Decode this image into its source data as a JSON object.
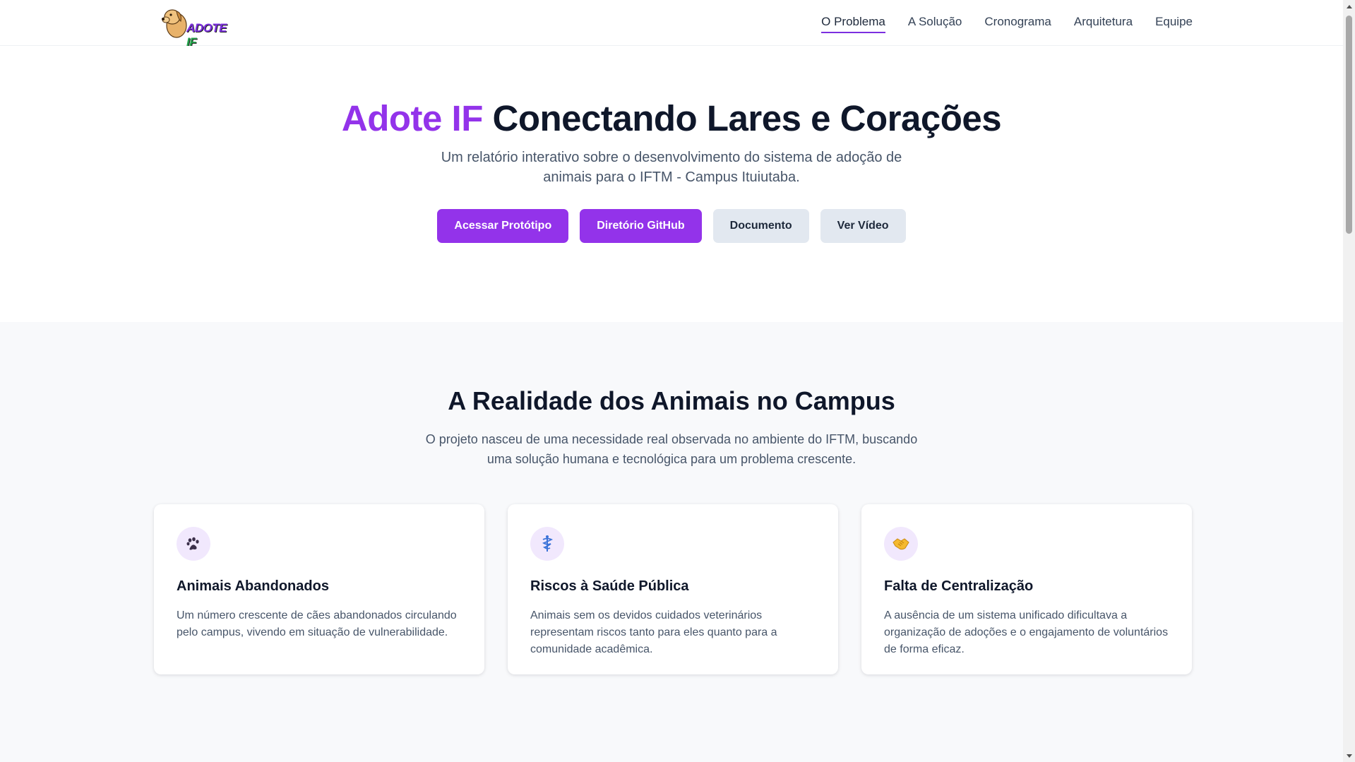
{
  "brand": {
    "logo_text": "ADOTE",
    "logo_text_if": "IF"
  },
  "nav": {
    "items": [
      {
        "label": "O Problema",
        "active": true
      },
      {
        "label": "A Solução",
        "active": false
      },
      {
        "label": "Cronograma",
        "active": false
      },
      {
        "label": "Arquitetura",
        "active": false
      },
      {
        "label": "Equipe",
        "active": false
      }
    ]
  },
  "hero": {
    "title_accent": "Adote IF",
    "title_rest": " Conectando Lares e Corações",
    "subtitle": "Um relatório interativo sobre o desenvolvimento do sistema de adoção de animais para o IFTM - Campus Ituiutaba.",
    "buttons": [
      {
        "label": "Acessar Protótipo",
        "style": "primary"
      },
      {
        "label": "Diretório GitHub",
        "style": "primary"
      },
      {
        "label": "Documento",
        "style": "secondary"
      },
      {
        "label": "Ver Vídeo",
        "style": "secondary"
      }
    ]
  },
  "problem": {
    "title": "A Realidade dos Animais no Campus",
    "lead": "O projeto nasceu de uma necessidade real observada no ambiente do IFTM, buscando uma solução humana e tecnológica para um problema crescente.",
    "cards": [
      {
        "icon": "paw-icon",
        "title": "Animais Abandonados",
        "text": "Um número crescente de cães abandonados circulando pelo campus, vivendo em situação de vulnerabilidade."
      },
      {
        "icon": "medical-icon",
        "title": "Riscos à Saúde Pública",
        "text": "Animais sem os devidos cuidados veterinários representam riscos tanto para eles quanto para a comunidade acadêmica."
      },
      {
        "icon": "handshake-icon",
        "title": "Falta de Centralização",
        "text": "A ausência de um sistema unificado dificultava a organização de adoções e o engajamento de voluntários de forma eficaz."
      }
    ]
  },
  "colors": {
    "accent": "#9333ea",
    "nav_underline": "#7c2fe0",
    "secondary_button": "#e2e8f0"
  }
}
